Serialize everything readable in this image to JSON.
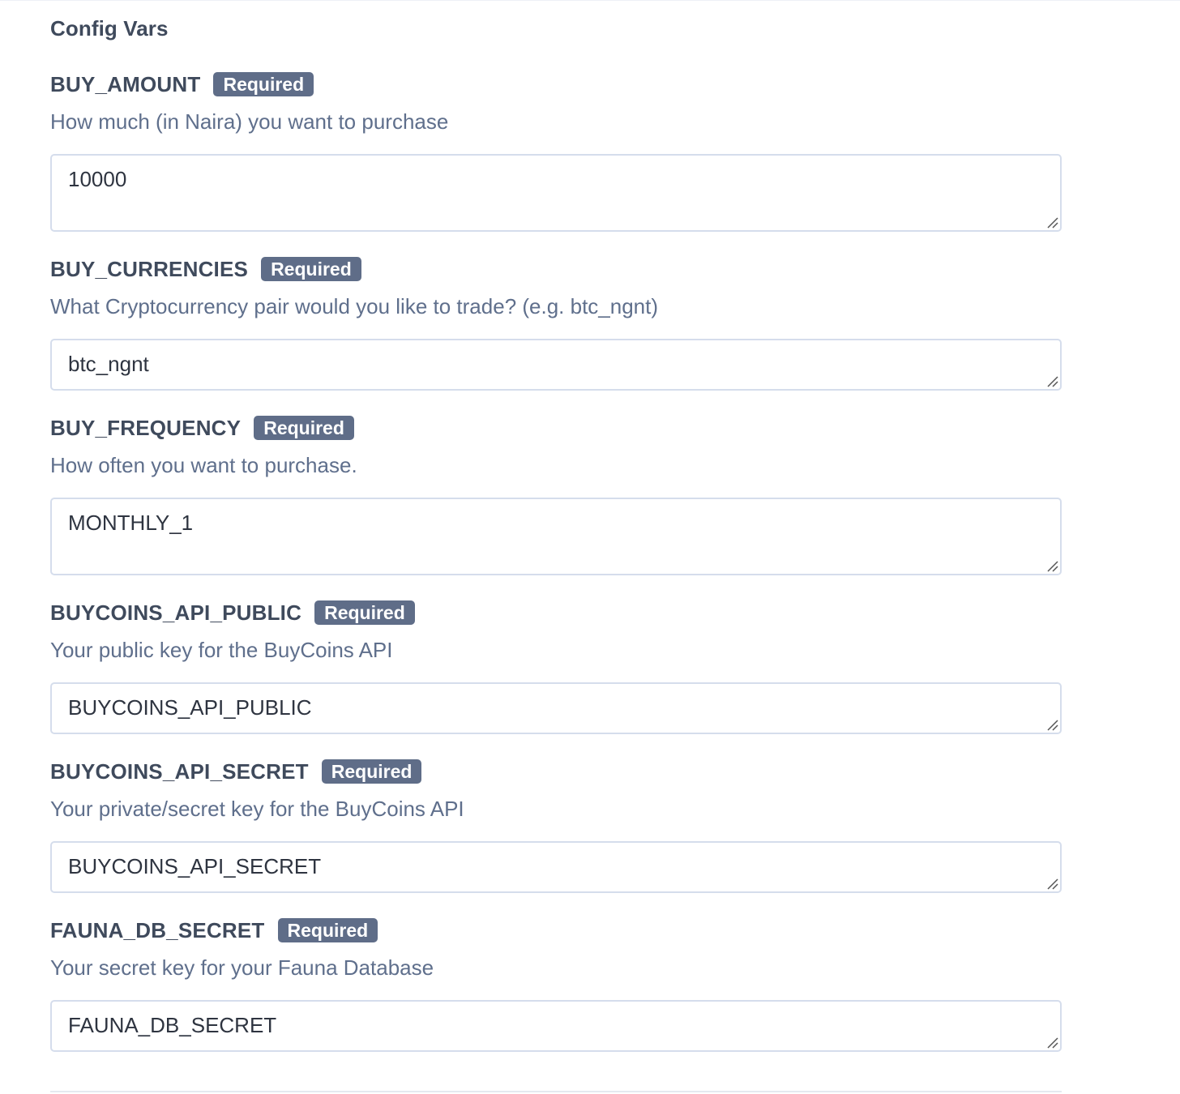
{
  "section": {
    "title": "Config Vars"
  },
  "badge_label": "Required",
  "fields": [
    {
      "name": "BUY_AMOUNT",
      "description": "How much (in Naira) you want to purchase",
      "value": "10000"
    },
    {
      "name": "BUY_CURRENCIES",
      "description": "What Cryptocurrency pair would you like to trade? (e.g. btc_ngnt)",
      "value": "btc_ngnt"
    },
    {
      "name": "BUY_FREQUENCY",
      "description": "How often you want to purchase.",
      "value": "MONTHLY_1"
    },
    {
      "name": "BUYCOINS_API_PUBLIC",
      "description": "Your public key for the BuyCoins API",
      "value": "BUYCOINS_API_PUBLIC"
    },
    {
      "name": "BUYCOINS_API_SECRET",
      "description": "Your private/secret key for the BuyCoins API",
      "value": "BUYCOINS_API_SECRET"
    },
    {
      "name": "FAUNA_DB_SECRET",
      "description": "Your secret key for your Fauna Database",
      "value": "FAUNA_DB_SECRET"
    }
  ],
  "colors": {
    "badge_bg": "#5f6d88",
    "label_text": "#3f4a5c",
    "description_text": "#5f6f8c",
    "input_border": "#d5ddec"
  }
}
